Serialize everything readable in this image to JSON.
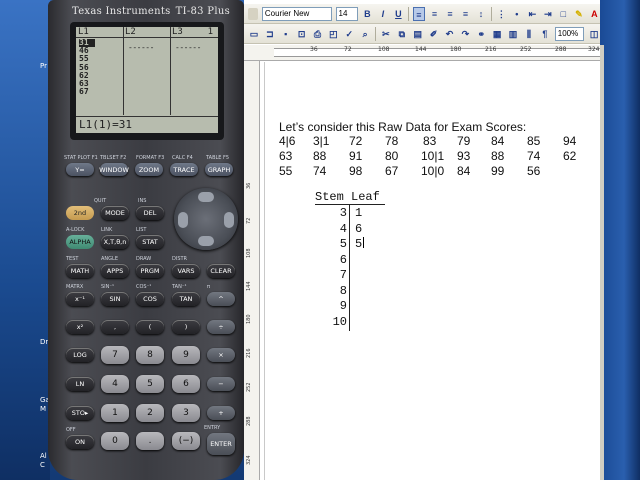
{
  "desktop": {
    "labels": [
      "Pr",
      "Dre",
      "Ga",
      "M",
      "Al",
      "C"
    ]
  },
  "calculator": {
    "brand": "Texas Instruments",
    "model": "TI-83 Plus",
    "screen": {
      "headers": [
        "L1",
        "L2",
        "L3",
        "1"
      ],
      "list1": [
        "31",
        "46",
        "55",
        "56",
        "62",
        "63",
        "67"
      ],
      "dashes": "------",
      "status": "L1(1)=31"
    },
    "keys": {
      "row_top": [
        "Y=",
        "WINDOW",
        "ZOOM",
        "TRACE",
        "GRAPH"
      ],
      "row_top_labels": [
        "STAT PLOT F1",
        "TBLSET F2",
        "FORMAT F3",
        "CALC F4",
        "TABLE F5"
      ],
      "row2": [
        "2nd",
        "MODE",
        "DEL"
      ],
      "row2_labels": [
        "QUIT",
        "INS"
      ],
      "row3": [
        "ALPHA",
        "X,T,θ,n",
        "STAT"
      ],
      "row3_labels": [
        "A-LOCK",
        "LINK",
        "LIST"
      ],
      "row4": [
        "MATH",
        "APPS",
        "PRGM",
        "VARS",
        "CLEAR"
      ],
      "row4_labels": [
        "TEST",
        "ANGLE",
        "DRAW",
        "DISTR"
      ],
      "row5": [
        "x⁻¹",
        "SIN",
        "COS",
        "TAN",
        "^"
      ],
      "row5_labels": [
        "MATRX",
        "SIN⁻¹",
        "COS⁻¹",
        "TAN⁻¹",
        "π"
      ],
      "row6": [
        "x²",
        ",",
        "(",
        ")",
        "÷"
      ],
      "row7": [
        "LOG",
        "7",
        "8",
        "9",
        "×"
      ],
      "row8": [
        "LN",
        "4",
        "5",
        "6",
        "−"
      ],
      "row9": [
        "STO▸",
        "1",
        "2",
        "3",
        "+"
      ],
      "row10": [
        "ON",
        "0",
        ".",
        "(−)",
        "ENTER"
      ],
      "row10_labels": [
        "OFF",
        "",
        "",
        "",
        "ENTRY"
      ]
    }
  },
  "word": {
    "toolbar": {
      "font_name": "Courier New",
      "font_size": "14",
      "zoom": "100%"
    },
    "ruler": [
      "36",
      "72",
      "108",
      "144",
      "180",
      "216",
      "252",
      "288",
      "324"
    ],
    "vruler": [
      "36",
      "72",
      "108",
      "144",
      "180",
      "216",
      "252",
      "288",
      "324"
    ],
    "document": {
      "heading": "Let’s consider this Raw Data for Exam Scores:",
      "rows": [
        [
          "4|6",
          "3|1",
          "72",
          "78",
          "83",
          "79",
          "84",
          "85",
          "94"
        ],
        [
          "63",
          "88",
          "91",
          "80",
          "10|1",
          "93",
          "88",
          "74",
          "62"
        ],
        [
          "55",
          "74",
          "98",
          "67",
          "10|0",
          "84",
          "99",
          "56",
          ""
        ]
      ],
      "stem_header": "Stem",
      "leaf_header": "Leaf",
      "stem_plot": [
        {
          "stem": "3",
          "leaf": "1"
        },
        {
          "stem": "4",
          "leaf": "6"
        },
        {
          "stem": "5",
          "leaf": "5"
        },
        {
          "stem": "6",
          "leaf": ""
        },
        {
          "stem": "7",
          "leaf": ""
        },
        {
          "stem": "8",
          "leaf": ""
        },
        {
          "stem": "9",
          "leaf": ""
        },
        {
          "stem": "10",
          "leaf": ""
        }
      ]
    }
  }
}
